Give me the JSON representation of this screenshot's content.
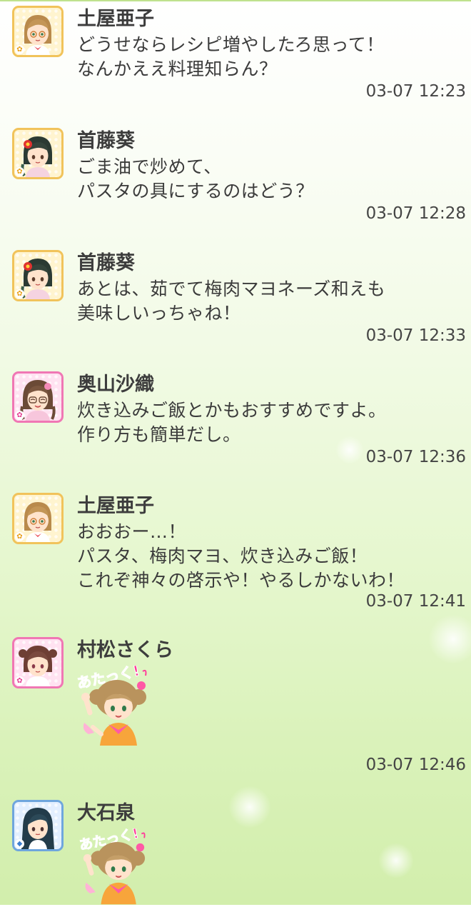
{
  "messages": [
    {
      "sender": "土屋亜子",
      "text": "どうせならレシピ増やしたろ思って！\nなんかええ料理知らん？",
      "time": "03-07 12:23",
      "avatar_icon": "ako-avatar-icon",
      "type": "cute"
    },
    {
      "sender": "首藤葵",
      "text": "ごま油で炒めて、\nパスタの具にするのはどう？",
      "time": "03-07 12:28",
      "avatar_icon": "aoi-avatar-icon",
      "type": "cute"
    },
    {
      "sender": "首藤葵",
      "text": "あとは、茹でて梅肉マヨネーズ和えも\n美味しいっちゃね！",
      "time": "03-07 12:33",
      "avatar_icon": "aoi-avatar-icon",
      "type": "cute"
    },
    {
      "sender": "奥山沙織",
      "text": "炊き込みご飯とかもおすすめですよ。\n作り方も簡単だし。",
      "time": "03-07 12:36",
      "avatar_icon": "saori-avatar-icon",
      "type": "cute"
    },
    {
      "sender": "土屋亜子",
      "text": "おおおー…！\nパスタ、梅肉マヨ、炊き込みご飯！\nこれぞ神々の啓示や！やるしかないわ！",
      "time": "03-07 12:41",
      "avatar_icon": "ako-avatar-icon",
      "type": "cute"
    },
    {
      "sender": "村松さくら",
      "sticker": "あたっく!",
      "time": "03-07 12:46",
      "avatar_icon": "sakura-avatar-icon",
      "type": "cute"
    },
    {
      "sender": "大石泉",
      "sticker": "あたっく!",
      "avatar_icon": "izumi-avatar-icon",
      "type": "cool"
    }
  ],
  "colors": {
    "cute_frame": "#f1c35b",
    "pink_frame": "#f077b4",
    "cool_frame": "#6fa6dd",
    "name_text": "#3d3d3d",
    "body_text": "#3b3b3b",
    "time_text": "#444444",
    "sticker_text": "#ff3d9a"
  }
}
